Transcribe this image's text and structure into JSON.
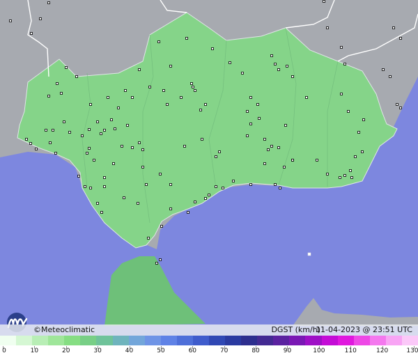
{
  "info_bar": {
    "copyright": "©Meteoclimatic",
    "product": "DGST (km/h)",
    "timestamp": "11-04-2023 @ 23:51 UTC"
  },
  "legend": {
    "ticks": [
      "0",
      "10",
      "20",
      "30",
      "40",
      "50",
      "60",
      "70",
      "80",
      "90",
      "100",
      "110",
      "120",
      "130"
    ],
    "colors": [
      "#f0fff0",
      "#d5f7d3",
      "#b8eeb5",
      "#9fe69a",
      "#86de83",
      "#78cf86",
      "#6fc39a",
      "#6fb4bd",
      "#73a6da",
      "#6f94e6",
      "#5f82e6",
      "#4e6fd9",
      "#3f5ccc",
      "#3048b4",
      "#2a3aa0",
      "#2d2e8e",
      "#432a92",
      "#5b22a0",
      "#7a18b4",
      "#9e10c6",
      "#c40cd6",
      "#e018de",
      "#ee48e6",
      "#f478ee",
      "#f8a4f4",
      "#fbc8f8"
    ]
  },
  "colors": {
    "sea": "#7d87df",
    "outside_land": "#a7aab0",
    "region_land": "#85d489",
    "africa_land": "#6ec079",
    "station_marker": "#000000"
  },
  "stations": [
    [
      15,
      30
    ],
    [
      58,
      27
    ],
    [
      70,
      4
    ],
    [
      45,
      48
    ],
    [
      95,
      97
    ],
    [
      110,
      110
    ],
    [
      82,
      120
    ],
    [
      88,
      134
    ],
    [
      70,
      138
    ],
    [
      130,
      150
    ],
    [
      155,
      140
    ],
    [
      170,
      155
    ],
    [
      190,
      140
    ],
    [
      200,
      100
    ],
    [
      215,
      125
    ],
    [
      235,
      130
    ],
    [
      240,
      150
    ],
    [
      260,
      140
    ],
    [
      275,
      120
    ],
    [
      280,
      130
    ],
    [
      268,
      55
    ],
    [
      305,
      70
    ],
    [
      330,
      90
    ],
    [
      348,
      105
    ],
    [
      360,
      140
    ],
    [
      370,
      150
    ],
    [
      355,
      160
    ],
    [
      360,
      178
    ],
    [
      372,
      170
    ],
    [
      355,
      195
    ],
    [
      380,
      200
    ],
    [
      385,
      215
    ],
    [
      390,
      210
    ],
    [
      400,
      212
    ],
    [
      410,
      180
    ],
    [
      420,
      110
    ],
    [
      412,
      95
    ],
    [
      400,
      100
    ],
    [
      395,
      92
    ],
    [
      390,
      80
    ],
    [
      440,
      140
    ],
    [
      490,
      135
    ],
    [
      500,
      160
    ],
    [
      515,
      190
    ],
    [
      522,
      172
    ],
    [
      520,
      218
    ],
    [
      510,
      225
    ],
    [
      495,
      252
    ],
    [
      503,
      245
    ],
    [
      505,
      255
    ],
    [
      488,
      255
    ],
    [
      470,
      250
    ],
    [
      455,
      230
    ],
    [
      420,
      230
    ],
    [
      408,
      240
    ],
    [
      380,
      235
    ],
    [
      395,
      265
    ],
    [
      402,
      270
    ],
    [
      360,
      265
    ],
    [
      335,
      260
    ],
    [
      320,
      270
    ],
    [
      310,
      268
    ],
    [
      300,
      280
    ],
    [
      295,
      285
    ],
    [
      280,
      290
    ],
    [
      270,
      305
    ],
    [
      245,
      300
    ],
    [
      232,
      325
    ],
    [
      213,
      342
    ],
    [
      230,
      373
    ],
    [
      225,
      378
    ],
    [
      146,
      305
    ],
    [
      140,
      292
    ],
    [
      130,
      270
    ],
    [
      122,
      268
    ],
    [
      150,
      268
    ],
    [
      150,
      255
    ],
    [
      163,
      235
    ],
    [
      205,
      240
    ],
    [
      210,
      265
    ],
    [
      230,
      250
    ],
    [
      245,
      265
    ],
    [
      175,
      210
    ],
    [
      190,
      212
    ],
    [
      200,
      205
    ],
    [
      205,
      215
    ],
    [
      183,
      180
    ],
    [
      165,
      185
    ],
    [
      160,
      172
    ],
    [
      150,
      187
    ],
    [
      145,
      192
    ],
    [
      140,
      175
    ],
    [
      128,
      186
    ],
    [
      118,
      195
    ],
    [
      100,
      190
    ],
    [
      92,
      175
    ],
    [
      76,
      187
    ],
    [
      66,
      187
    ],
    [
      72,
      205
    ],
    [
      80,
      220
    ],
    [
      44,
      206
    ],
    [
      38,
      200
    ],
    [
      52,
      214
    ],
    [
      113,
      253
    ],
    [
      198,
      292
    ],
    [
      178,
      284
    ],
    [
      135,
      230
    ],
    [
      128,
      213
    ],
    [
      180,
      130
    ],
    [
      125,
      220
    ],
    [
      465,
      2
    ],
    [
      470,
      40
    ],
    [
      490,
      68
    ],
    [
      495,
      92
    ],
    [
      550,
      100
    ],
    [
      560,
      110
    ],
    [
      570,
      150
    ],
    [
      575,
      155
    ],
    [
      565,
      40
    ],
    [
      575,
      55
    ],
    [
      265,
      210
    ],
    [
      290,
      200
    ],
    [
      310,
      225
    ],
    [
      315,
      218
    ],
    [
      288,
      158
    ],
    [
      295,
      150
    ],
    [
      228,
      60
    ],
    [
      245,
      95
    ],
    [
      277,
      125
    ],
    [
      420,
      230
    ]
  ],
  "island_marker": [
    444,
    365
  ]
}
